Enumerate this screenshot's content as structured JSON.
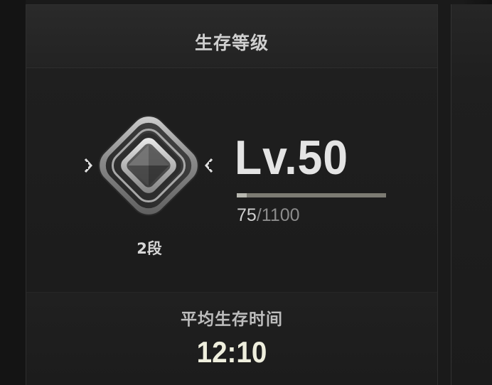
{
  "panel": {
    "title": "生存等级"
  },
  "rank": {
    "icon": "diamond-rank-badge-icon",
    "tier_label": "2段"
  },
  "level": {
    "label": "Lv.50",
    "xp_current": "75",
    "xp_separator": "/",
    "xp_max": "1100",
    "xp_fraction": 0.068
  },
  "average_survival": {
    "label": "平均生存时间",
    "value": "12:10"
  },
  "colors": {
    "background": "#1a1a1a",
    "title_text": "#cfcfcf",
    "level_text": "#e4e4e4",
    "xp_track": "#7c7b73",
    "xp_fill": "#b8b8b0",
    "value_text": "#eeeedd"
  }
}
